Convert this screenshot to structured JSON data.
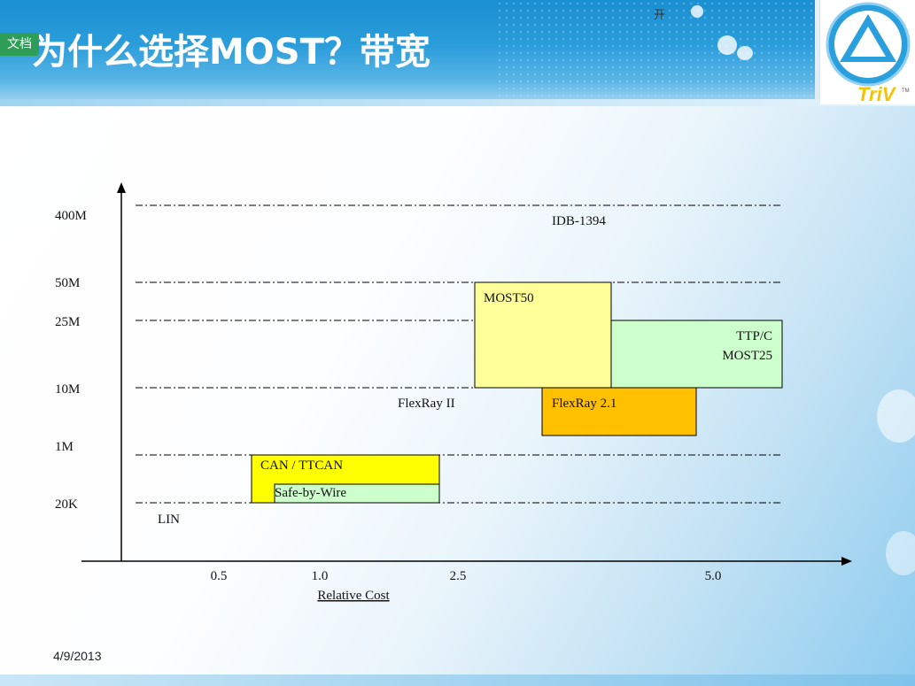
{
  "header": {
    "title": "为什么选择MOST？带宽",
    "doc_tag": "文档",
    "top_char": "开",
    "logo_text": "TriV",
    "logo_tm": "TM"
  },
  "footer": {
    "date": "4/9/2013"
  },
  "colors": {
    "light_yellow": "#ffff99",
    "yellow": "#ffff00",
    "orange": "#ffc000",
    "light_green": "#ccffcc",
    "header_blue": "#1a8fd1"
  },
  "chart_data": {
    "type": "bar",
    "xlabel": "Relative Cost",
    "ylabel": "",
    "x_ticks": [
      "0.5",
      "1.0",
      "2.5",
      "5.0"
    ],
    "y_ticks": [
      "20K",
      "1M",
      "10M",
      "25M",
      "50M",
      "400M"
    ],
    "grid": "dash-dot horizontal lines at each y tick",
    "boxes": [
      {
        "label": "LIN",
        "x_from": 0.4,
        "x_to": 1.0,
        "y_from": "0",
        "y_to": "20K",
        "color": "#ffff99"
      },
      {
        "label": "",
        "x_from": 1.0,
        "x_to": 2.4,
        "y_from": "0",
        "y_to": "20K",
        "color": "#ffff00"
      },
      {
        "label": "CAN / TTCAN",
        "x_from": 0.65,
        "x_to": 2.4,
        "y_from": "20K",
        "y_to": "1M",
        "color": "#ffff00"
      },
      {
        "label": "Safe-by-Wire",
        "x_from": 0.75,
        "x_to": 2.4,
        "y_from": "20K",
        "y_to": "between 20K and 1M",
        "color": "#ccffcc"
      },
      {
        "label": "FlexRay II",
        "x_from": 2.0,
        "x_to": 3.3,
        "y_from": "between 1M and 10M",
        "y_to": "10M",
        "color": "#ffc000"
      },
      {
        "label": "FlexRay 2.1",
        "x_from": 3.3,
        "x_to": 4.7,
        "y_from": "between 1M and 10M",
        "y_to": "10M",
        "color": "#ffc000"
      },
      {
        "label": "MOST50",
        "x_from": 2.8,
        "x_to": 3.9,
        "y_from": "10M",
        "y_to": "50M",
        "color": "#ffff99"
      },
      {
        "label": "IDB-1394",
        "x_from": 3.3,
        "x_to": 5.0,
        "y_from": "25M",
        "y_to": "400M",
        "color": "#ccffcc"
      },
      {
        "label": "TTP/C\nMOST25",
        "x_from": 3.9,
        "x_to": 5.6,
        "y_from": "10M",
        "y_to": "25M",
        "color": "#ccffcc"
      }
    ]
  }
}
